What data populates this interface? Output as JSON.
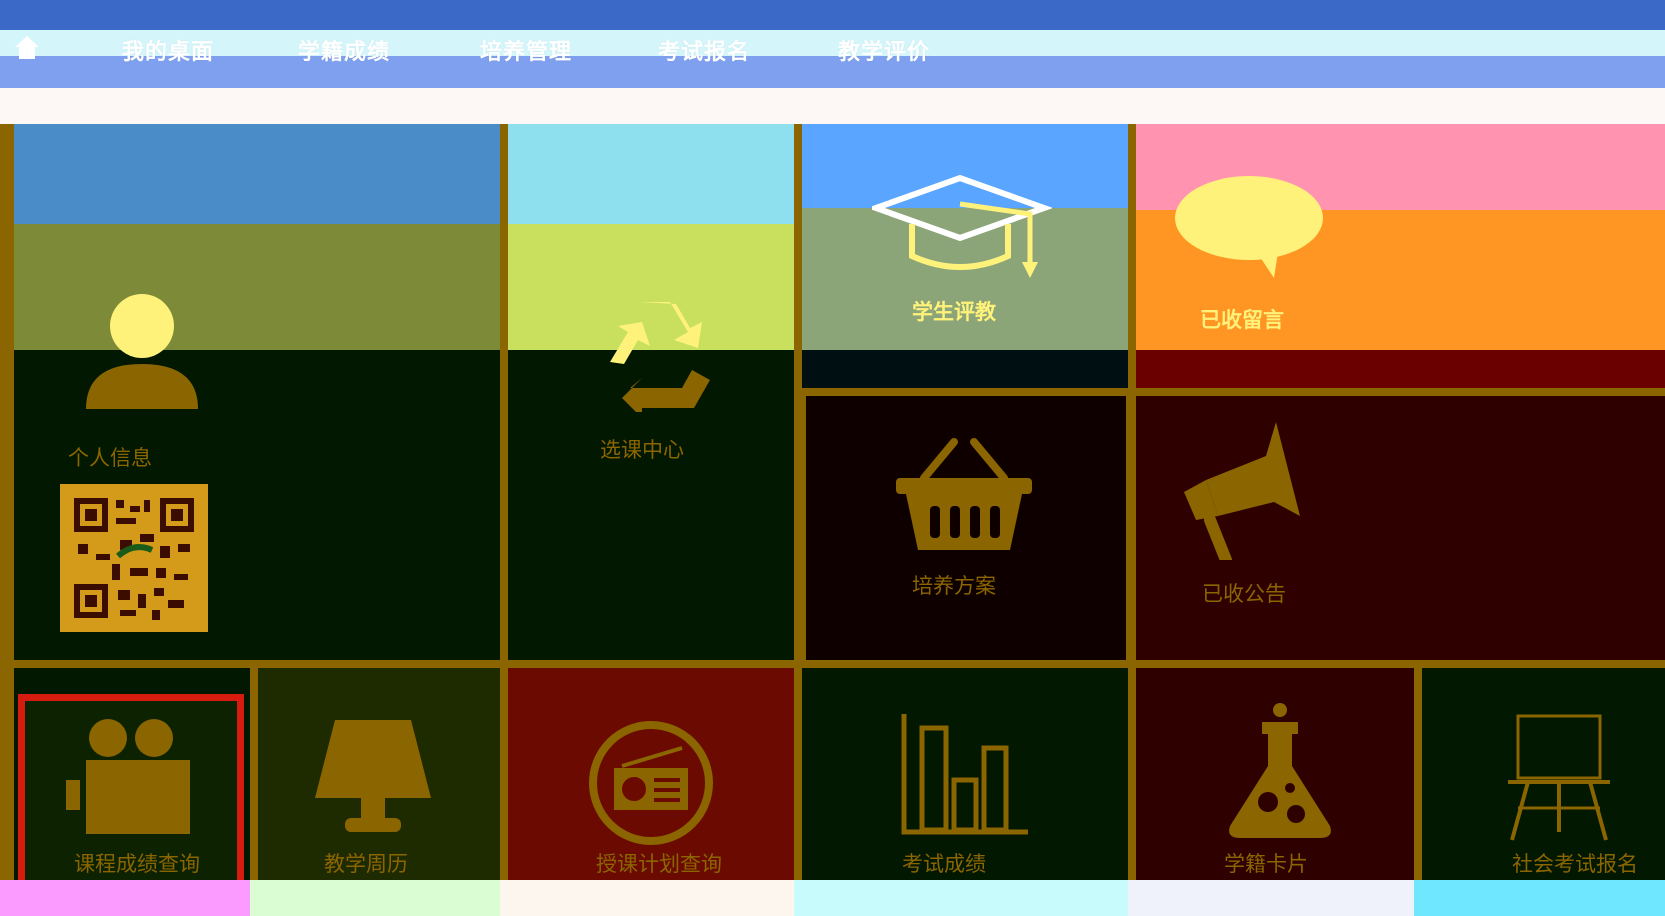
{
  "nav": {
    "items": [
      {
        "label": "我的桌面"
      },
      {
        "label": "学籍成绩"
      },
      {
        "label": "培养管理"
      },
      {
        "label": "考试报名"
      },
      {
        "label": "教学评价"
      }
    ]
  },
  "tiles": {
    "profile": {
      "label": "个人信息"
    },
    "course_select": {
      "label": "选课中心"
    },
    "student_eval": {
      "label": "学生评教"
    },
    "messages": {
      "label": "已收留言"
    },
    "program_plan": {
      "label": "培养方案"
    },
    "announcements": {
      "label": "已收公告"
    },
    "course_grades": {
      "label": "课程成绩查询"
    },
    "teaching_calendar": {
      "label": "教学周历"
    },
    "teaching_plan": {
      "label": "授课计划查询"
    },
    "exam_grades": {
      "label": "考试成绩"
    },
    "student_card": {
      "label": "学籍卡片"
    },
    "social_exam": {
      "label": "社会考试报名"
    }
  },
  "colors": {
    "topbar": "#3b69c7",
    "accent_gold": "#8a6500",
    "tile_green_dark": "#021800",
    "tile_maroon": "#2e0000",
    "tile_red": "#6b0a00",
    "tile_orange": "#ff9623",
    "icon_yellow": "#fff27a"
  }
}
